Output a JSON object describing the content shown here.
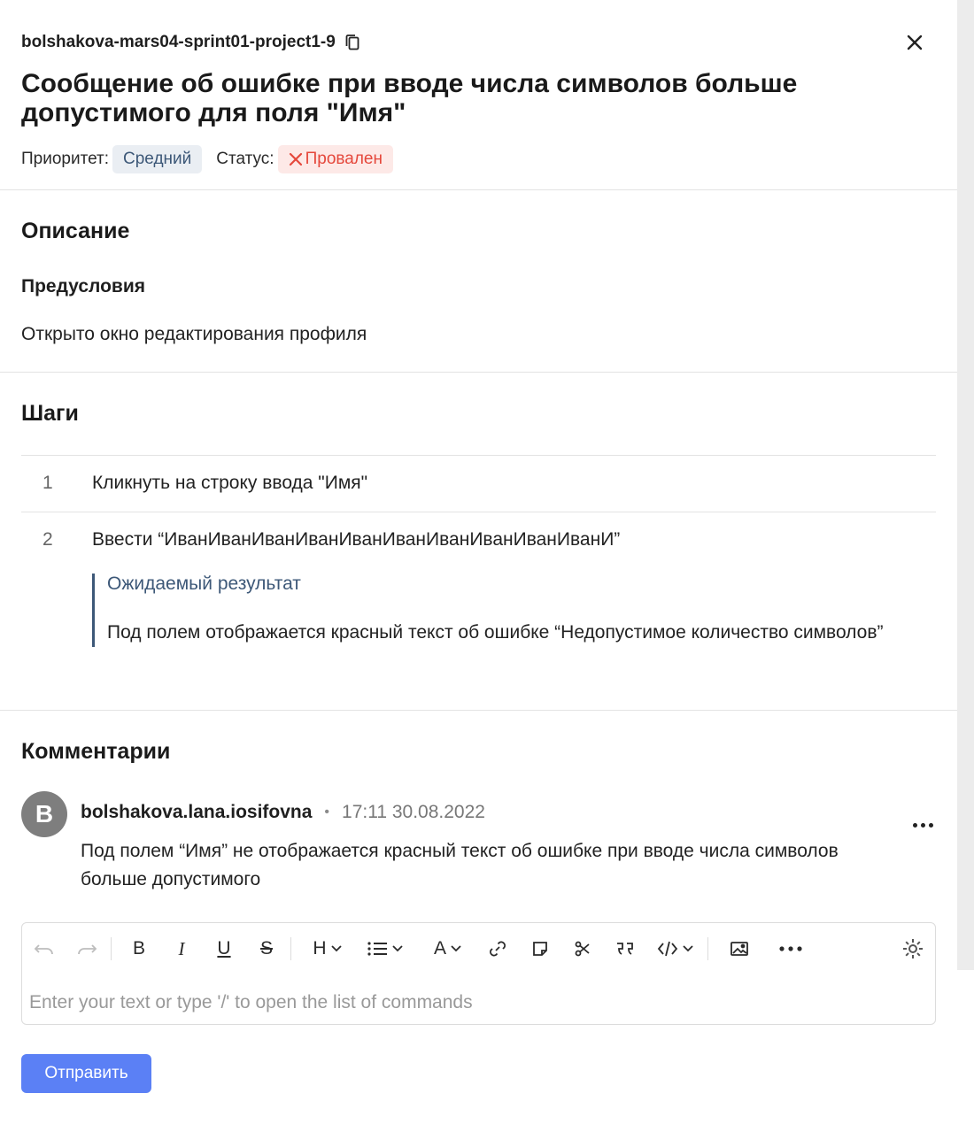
{
  "header": {
    "case_id": "bolshakova-mars04-sprint01-project1-9",
    "title": "Сообщение об ошибке при вводе числа символов больше допустимого для поля \"Имя\"",
    "priority_label": "Приоритет:",
    "priority_value": "Средний",
    "status_label": "Статус:",
    "status_value": "Провален",
    "status_icon": "cross-icon",
    "copy_icon": "copy-icon",
    "close_icon": "close-icon"
  },
  "description": {
    "heading": "Описание",
    "preconditions_heading": "Предусловия",
    "preconditions_text": "Открыто окно редактирования профиля"
  },
  "steps": {
    "heading": "Шаги",
    "items": [
      {
        "number": "1",
        "text": "Кликнуть на строку ввода \"Имя\""
      },
      {
        "number": "2",
        "text": "Ввести “ИванИванИванИванИванИванИванИванИванИванИ”",
        "expected_title": "Ожидаемый результат",
        "expected_text": "Под полем отображается красный текст об ошибке “Недопустимое количество символов”"
      }
    ]
  },
  "comments": {
    "heading": "Комментарии",
    "items": [
      {
        "avatar_letter": "B",
        "author": "bolshakova.lana.iosifovna",
        "separator": "•",
        "time": "17:11 30.08.2022",
        "text": "Под полем “Имя” не отображается красный текст об ошибке при вводе числа символов больше допустимого"
      }
    ]
  },
  "editor": {
    "toolbar": {
      "bold": "B",
      "italic": "I",
      "underline": "U",
      "strike": "S",
      "heading": "H",
      "text_color": "A"
    },
    "placeholder": "Enter your text or type '/' to open the list of commands"
  },
  "submit_label": "Отправить",
  "colors": {
    "accent": "#5b80f5",
    "status_red": "#e5483c",
    "priority_blue": "#3d5878"
  }
}
